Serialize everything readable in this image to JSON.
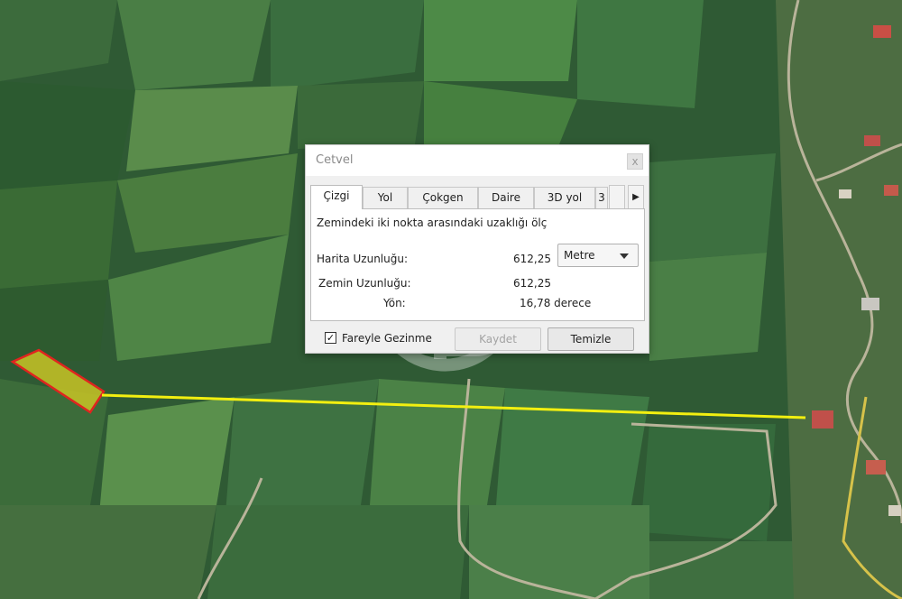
{
  "dialog": {
    "title": "Cetvel",
    "close_glyph": "x",
    "tabs": [
      "Çizgi",
      "Yol",
      "Çokgen",
      "Daire",
      "3D yol",
      "3"
    ],
    "active_tab": "Çizgi",
    "scroll_right_glyph": "▶",
    "description": "Zemindeki iki nokta arasındaki uzaklığı ölç",
    "map_length_label": "Harita Uzunluğu:",
    "map_length_value": "612,25",
    "unit_selected": "Metre",
    "ground_length_label": "Zemin Uzunluğu:",
    "ground_length_value": "612,25",
    "heading_label": "Yön:",
    "heading_value": "16,78 derece",
    "mouse_nav_checked": true,
    "mouse_nav_label": "Fareyle Gezinme",
    "save_label": "Kaydet",
    "clear_label": "Temizle"
  },
  "map": {
    "type": "satellite imagery",
    "parcel_outline_color": "#e0241f",
    "parcel_fill_color": "#c8c426",
    "measure_line_color": "#f2ef10"
  }
}
